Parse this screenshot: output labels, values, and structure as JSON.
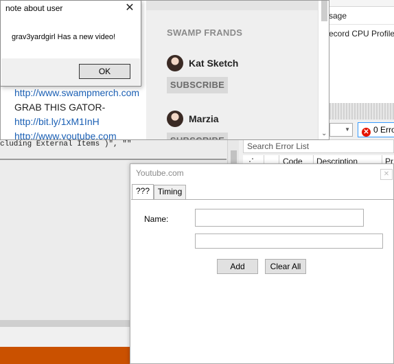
{
  "ide": {
    "code_line": "cluding External Items )\", \"\"",
    "right_panel": {
      "column_label": "sage",
      "row_text": "ecord CPU Profile"
    },
    "error_list": {
      "errors_label": "0 Erro",
      "search_placeholder": "Search Error List",
      "columns": [
        "Code",
        "Description",
        "Pr"
      ]
    },
    "colors": {
      "status_bar": "#ca5100",
      "error_badge": "#e51400"
    }
  },
  "browser": {
    "links": [
      {
        "text": "http://www.swampmerch.com",
        "kind": "link"
      },
      {
        "text": "GRAB THIS GATOR-",
        "kind": "text"
      },
      {
        "text": "http://bit.ly/1xM1InH",
        "kind": "link"
      },
      {
        "text": "http://www.youtube.com",
        "kind": "link"
      }
    ],
    "sidebar": {
      "title": "SWAMP FRANDS",
      "friends": [
        {
          "name": "Kat Sketch",
          "button": "SUBSCRIBE"
        },
        {
          "name": "Marzia",
          "button": "SUBSCRIBE"
        }
      ]
    }
  },
  "message_box": {
    "title": "note about user",
    "message": "grav3yardgirl Has a new video!",
    "ok_label": "OK"
  },
  "youtube_form": {
    "title": "Youtube.com",
    "tabs": [
      "???",
      "Timing"
    ],
    "name_label": "Name:",
    "name_value": "",
    "second_value": "",
    "add_label": "Add",
    "clear_label": "Clear All"
  }
}
